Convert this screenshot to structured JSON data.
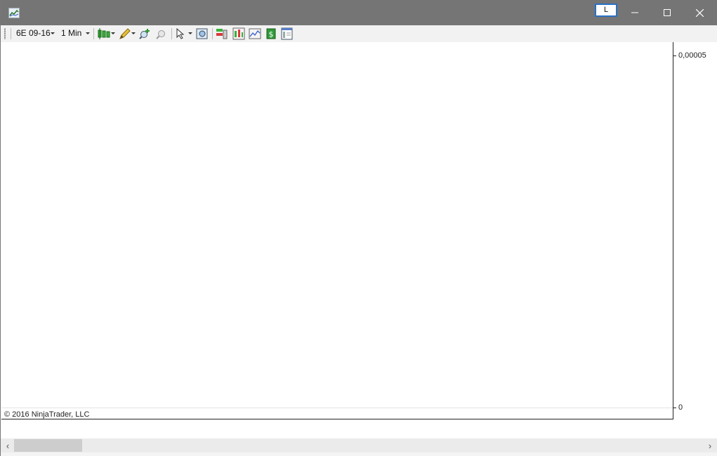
{
  "window": {
    "link_button_label": "L"
  },
  "toolbar": {
    "instrument": "6E 09-16",
    "interval": "1 Min",
    "icons": [
      "candlestick-icon",
      "pencil-draw-icon",
      "zoom-in-icon",
      "zoom-out-icon",
      "pointer-icon",
      "data-box-icon",
      "chart-trader-icon",
      "bar-chart-icon",
      "line-chart-icon",
      "dollar-icon",
      "properties-icon"
    ]
  },
  "chart": {
    "copyright": "© 2016 NinjaTrader, LLC",
    "y_axis_labels": [
      "0,00005",
      "0"
    ]
  },
  "chart_data": {
    "type": "line",
    "series": [],
    "y_ticks": [
      5e-05,
      0
    ],
    "tick_labels": [
      "0,00005",
      "0"
    ],
    "ylim": [
      0,
      5e-05
    ],
    "grid": false
  }
}
